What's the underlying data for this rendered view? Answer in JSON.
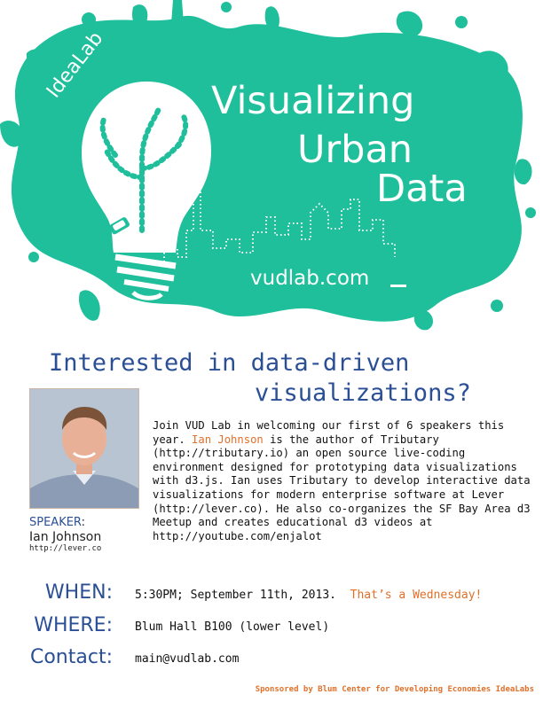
{
  "header": {
    "idealab": "IdeaLab",
    "title_line1": "Visualizing",
    "title_line2": "Urban",
    "title_line3": "Data",
    "site": "vudlab.com"
  },
  "headline": {
    "line1": "Interested in data-driven",
    "line2": "visualizations?"
  },
  "speaker": {
    "label_prefix": "SPEAKER",
    "label_suffix": ":",
    "name": "Ian Johnson",
    "url": "http://lever.co"
  },
  "description": {
    "part1": "Join VUD Lab in welcoming our first of 6 speakers this year. ",
    "highlight": "Ian Johnson",
    "part2": " is the author of Tributary (http://tributary.io) an open source  live-coding environment designed for prototyping data visualizations with d3.js. Ian uses Tributary to develop interactive data visualizations for modern enterprise software at Lever (http://lever.co). He also co-organizes the SF Bay Area d3 Meetup and creates educational d3 videos at http://youtube.com/enjalot"
  },
  "details": {
    "when_label": "WHEN:",
    "when_value": "5:30PM; September 11th, 2013.",
    "when_note": "That’s a Wednesday!",
    "where_label": "WHERE:",
    "where_value": "Blum Hall B100 (lower level)",
    "contact_label": "Contact:",
    "contact_value": "main@vudlab.com"
  },
  "footer": "Sponsored by Blum Center for Developing Economies IdeaLabs",
  "colors": {
    "splash": "#1fbf9c",
    "splash_dark": "#16a585",
    "headline_blue": "#2a4f95",
    "accent_orange": "#e0702a"
  }
}
